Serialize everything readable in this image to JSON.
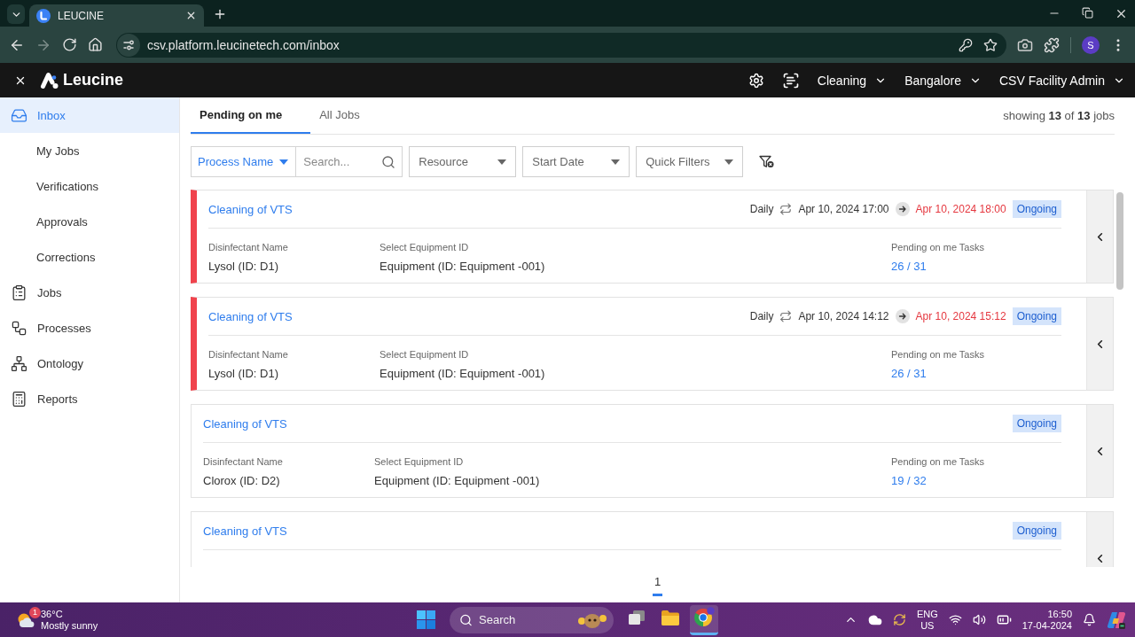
{
  "browser": {
    "tabs": [
      {
        "title": "LEUCINE",
        "selected": true
      }
    ],
    "url": "csv.platform.leucinetech.com/inbox",
    "profile": "S"
  },
  "header": {
    "brand": "Leucine",
    "selectors": [
      {
        "value": "Cleaning"
      },
      {
        "value": "Bangalore"
      },
      {
        "value": "CSV Facility Admin"
      }
    ]
  },
  "sidebar": {
    "items": [
      {
        "label": "Inbox",
        "selected": true,
        "children": [
          {
            "label": "My Jobs",
            "selected": false
          },
          {
            "label": "Verifications",
            "selected": false
          },
          {
            "label": "Approvals",
            "selected": false
          },
          {
            "label": "Corrections",
            "selected": false
          }
        ]
      },
      {
        "label": "Jobs",
        "selected": false
      },
      {
        "label": "Processes",
        "selected": false
      },
      {
        "label": "Ontology",
        "selected": false
      },
      {
        "label": "Reports",
        "selected": false
      }
    ]
  },
  "tabs": [
    {
      "label": "Pending on me",
      "selected": true
    },
    {
      "label": "All Jobs",
      "selected": false
    }
  ],
  "result_count": "showing **13** of **13** jobs",
  "filters": {
    "process": {
      "label": "Process Name"
    },
    "search": {
      "placeholder": "Search..."
    },
    "dropdowns": [
      {
        "placeholder": "Resource"
      },
      {
        "placeholder": "Start Date"
      },
      {
        "placeholder": "Quick Filters"
      }
    ]
  },
  "jobs": [
    {
      "title": "Cleaning of VTS",
      "overdue": true,
      "schedule": {
        "frequency": "Daily",
        "start": "Apr 10, 2024 17:00",
        "end": "Apr 10, 2024 18:00"
      },
      "status": "Ongoing",
      "fields": [
        {
          "label": "Disinfectant Name",
          "value": "Lysol (ID: D1)",
          "kind": "text"
        },
        {
          "label": "Select Equipment ID",
          "value": "Equipment (ID: Equipment -001)",
          "kind": "text"
        },
        {
          "label": "Pending on me Tasks",
          "value": "26 / 31",
          "kind": "link"
        }
      ]
    },
    {
      "title": "Cleaning of VTS",
      "overdue": true,
      "schedule": {
        "frequency": "Daily",
        "start": "Apr 10, 2024 14:12",
        "end": "Apr 10, 2024 15:12"
      },
      "status": "Ongoing",
      "fields": [
        {
          "label": "Disinfectant Name",
          "value": "Lysol (ID: D1)",
          "kind": "text"
        },
        {
          "label": "Select Equipment ID",
          "value": "Equipment (ID: Equipment -001)",
          "kind": "text"
        },
        {
          "label": "Pending on me Tasks",
          "value": "26 / 31",
          "kind": "link"
        }
      ]
    },
    {
      "title": "Cleaning of VTS",
      "overdue": false,
      "status": "Ongoing",
      "fields": [
        {
          "label": "Disinfectant Name",
          "value": "Clorox (ID: D2)",
          "kind": "text"
        },
        {
          "label": "Select Equipment ID",
          "value": "Equipment (ID: Equipment -001)",
          "kind": "text"
        },
        {
          "label": "Pending on me Tasks",
          "value": "19 / 32",
          "kind": "link"
        }
      ]
    },
    {
      "title": "Cleaning of VTS",
      "overdue": false,
      "status": "Ongoing"
    }
  ],
  "pagination": [
    {
      "label": "1",
      "selected": true
    }
  ],
  "taskbar": {
    "weather": {
      "temperature": "36°C",
      "condition": "Mostly sunny",
      "alerts": "1"
    },
    "search": {
      "placeholder": "Search"
    },
    "apps": [
      {
        "selected": false
      },
      {
        "selected": false
      },
      {
        "selected": true
      }
    ],
    "language": "ENG",
    "region": "US",
    "time": "16:50",
    "date": "17-04-2024"
  }
}
